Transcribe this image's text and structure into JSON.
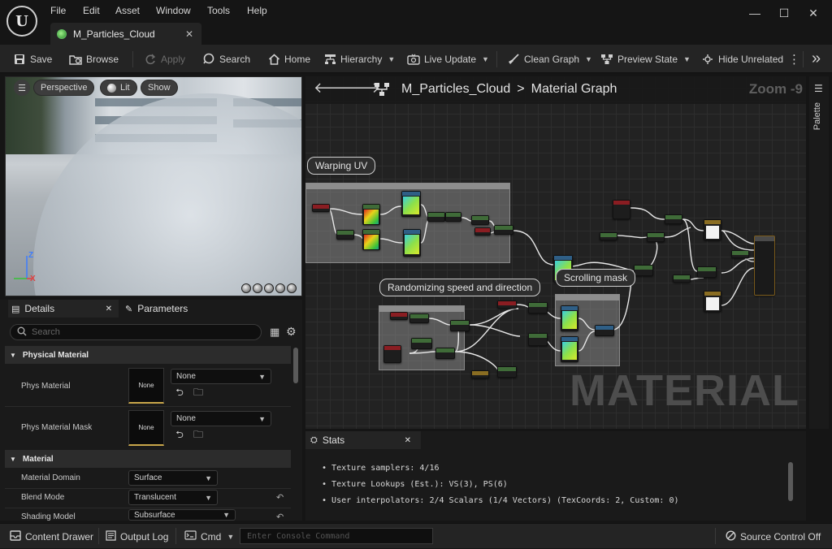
{
  "window": {
    "logo_text": "U",
    "menu": [
      "File",
      "Edit",
      "Asset",
      "Window",
      "Tools",
      "Help"
    ],
    "doc_tab": "M_Particles_Cloud",
    "min_glyph": "—",
    "max_glyph": "☐",
    "close_glyph": "✕"
  },
  "toolbar": {
    "save": "Save",
    "browse": "Browse",
    "apply": "Apply",
    "search": "Search",
    "home": "Home",
    "hierarchy": "Hierarchy",
    "live_update": "Live Update",
    "clean_graph": "Clean Graph",
    "preview_state": "Preview State",
    "hide_unrelated": "Hide Unrelated",
    "more": "⋮",
    "expand": "»"
  },
  "viewport": {
    "perspective": "Perspective",
    "lit": "Lit",
    "show": "Show",
    "axis_z": "Z",
    "axis_x": "X"
  },
  "details": {
    "tab_details": "Details",
    "tab_parameters": "Parameters",
    "tab_close": "✕",
    "search_placeholder": "Search",
    "cat_physical": "Physical Material",
    "phys_material": "Phys Material",
    "phys_material_mask": "Phys Material Mask",
    "thumb_none": "None",
    "combo_none": "None",
    "cat_material": "Material",
    "material_domain": "Material Domain",
    "material_domain_value": "Surface",
    "blend_mode": "Blend Mode",
    "blend_mode_value": "Translucent",
    "shading_model": "Shading Model",
    "shading_model_value": "Subsurface"
  },
  "graph": {
    "asset": "M_Particles_Cloud",
    "sep": ">",
    "view": "Material Graph",
    "zoom": "Zoom -9",
    "watermark": "MATERIAL",
    "comment_warping": "Warping UV",
    "comment_randomizing": "Randomizing speed and direction",
    "comment_scrolling": "Scrolling mask"
  },
  "palette": {
    "label": "Palette"
  },
  "stats": {
    "tab": "Stats",
    "lines": [
      "Texture samplers: 4/16",
      "Texture Lookups (Est.): VS(3), PS(6)",
      "User interpolators: 2/4 Scalars (1/4 Vectors) (TexCoords: 2, Custom: 0)"
    ]
  },
  "bottom": {
    "content_drawer": "Content Drawer",
    "output_log": "Output Log",
    "cmd": "Cmd",
    "console_placeholder": "Enter Console Command",
    "source_control": "Source Control Off"
  }
}
